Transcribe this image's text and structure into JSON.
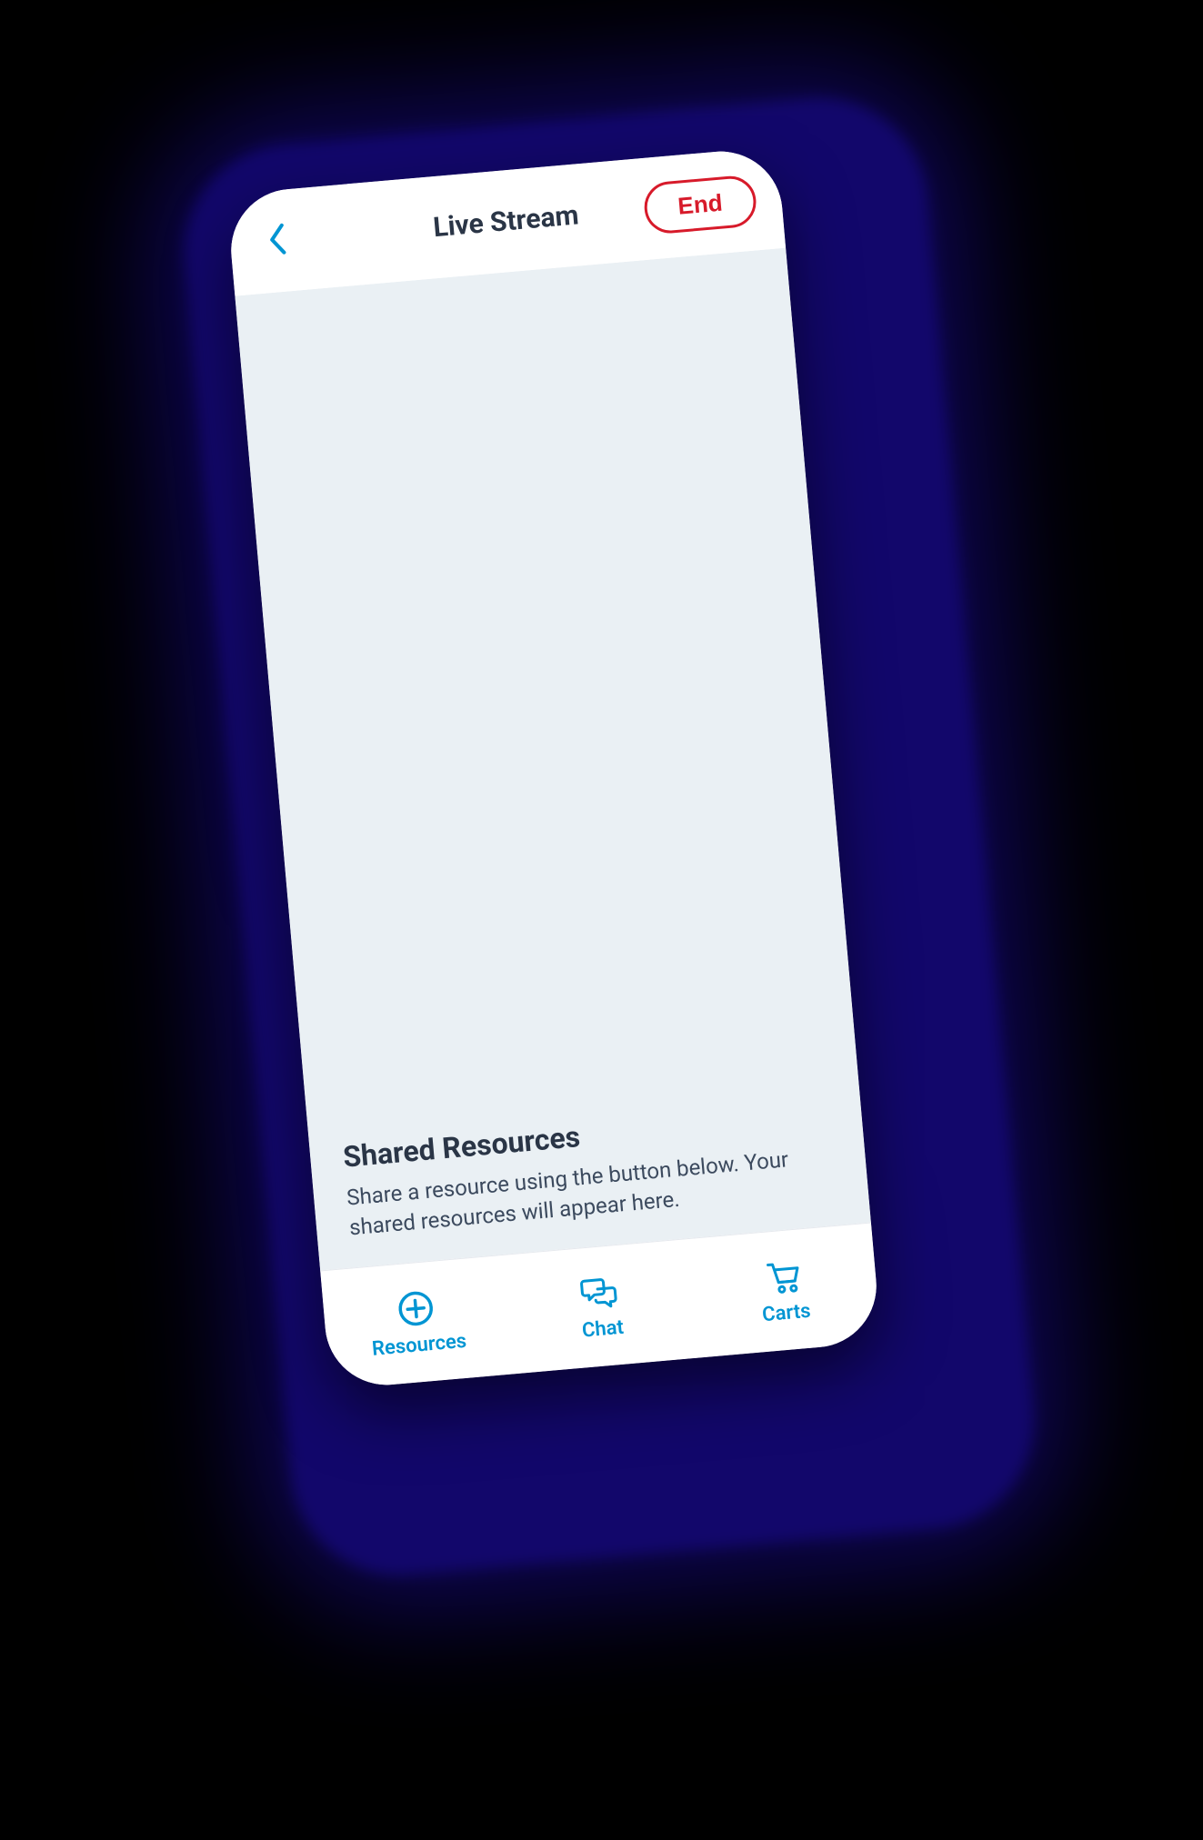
{
  "header": {
    "title": "Live Stream",
    "end_label": "End"
  },
  "shared": {
    "title": "Shared Resources",
    "desc": "Share a resource using the button below. Your shared resources will appear here."
  },
  "tabs": {
    "resources": "Resources",
    "chat": "Chat",
    "carts": "Carts"
  },
  "colors": {
    "accent": "#0095d3",
    "danger": "#d71a2a",
    "halo": "#12076b"
  },
  "icons": {
    "back": "chevron-left-icon",
    "resources": "plus-circle-icon",
    "chat": "chat-bubbles-icon",
    "carts": "cart-icon"
  }
}
